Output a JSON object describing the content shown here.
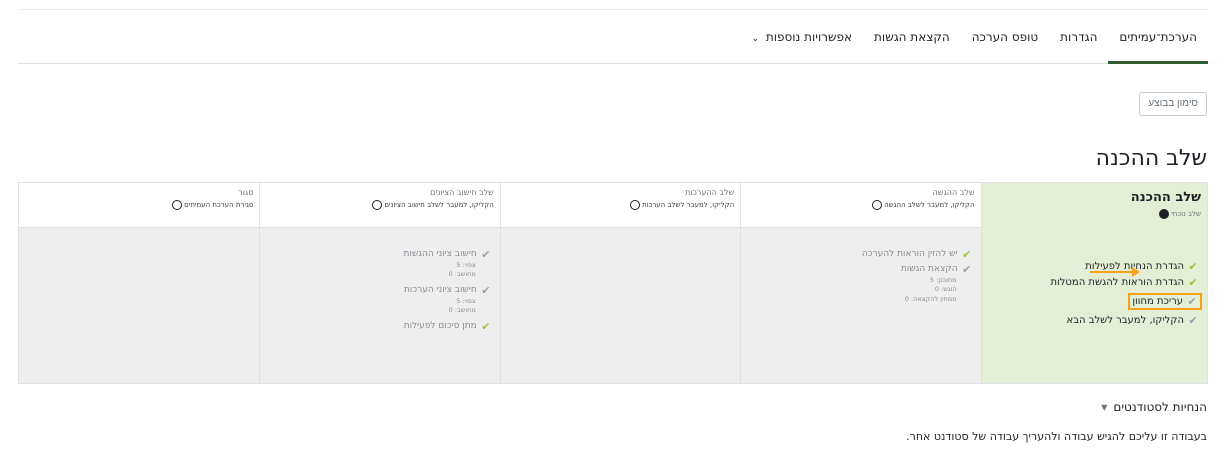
{
  "tabs": [
    {
      "label": "הערכת־עמיתים",
      "active": true
    },
    {
      "label": "הגדרות",
      "active": false
    },
    {
      "label": "טופס הערכה",
      "active": false
    },
    {
      "label": "הקצאת הגשות",
      "active": false
    },
    {
      "label": "אפשרויות נוספות",
      "active": false,
      "has_dropdown": true
    }
  ],
  "edit_button_label": "סימון בבוצע",
  "page_title": "שלב ההכנה",
  "phases": [
    {
      "name": "שלב ההכנה",
      "hint": "שלב נוכחי",
      "active": true,
      "tasks": [
        {
          "label": "הגדרת הנחיות לפעילות",
          "status": "done"
        },
        {
          "label": "הגדרת הוראות להגשת המטלות",
          "status": "done"
        },
        {
          "label": "עריכת מחוון",
          "status": "pending",
          "highlighted": true
        },
        {
          "label": "הקליקו, למעבר לשלב הבא",
          "status": "pending"
        }
      ]
    },
    {
      "name": "שלב ההגשה",
      "hint": "הקליקו, למעבר לשלב ההגשה",
      "active": false,
      "tasks": [
        {
          "label": "יש להזין הוראות להערכה",
          "status": "done",
          "details": []
        },
        {
          "label": "הקצאת הגשות",
          "status": "pending",
          "details": [
            "מתוכנן: 5",
            "הוגש: 0",
            "ממתין להקצאה: 0"
          ]
        }
      ]
    },
    {
      "name": "שלב ההערכות",
      "hint": "הקליקו, למעבר לשלב הערכות",
      "active": false,
      "tasks": []
    },
    {
      "name": "שלב חישוב הציונים",
      "hint": "הקליקו, למעבר לשלב חישוב הציונים",
      "active": false,
      "tasks": [
        {
          "label": "חישוב ציוני ההגשות",
          "status": "pending",
          "details": [
            "צפוי: 5",
            "מחושב: 0"
          ]
        },
        {
          "label": "חישוב ציוני הערכות",
          "status": "pending",
          "details": [
            "צפוי: 5",
            "מחושב: 0"
          ]
        },
        {
          "label": "מתן סיכום לפעילות",
          "status": "done",
          "details": []
        }
      ]
    },
    {
      "name": "סגור",
      "hint": "סגירת הערכת העמיתים",
      "active": false,
      "tasks": []
    }
  ],
  "instructions_section": {
    "heading": "הנחיות לסטודנטים",
    "text": "בעבודה זו עליכם להגיש עבודה ולהעריך עבודה של סטודנט אחר."
  },
  "colors": {
    "active_phase_bg": "#e3eed5",
    "check_done": "#9bc53d",
    "highlight": "#f7a21b",
    "tab_active_underline": "#2e5d34"
  }
}
